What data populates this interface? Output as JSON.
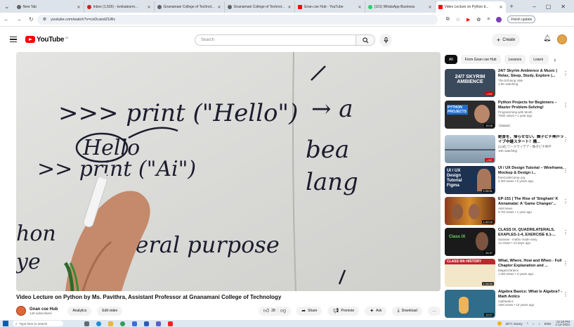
{
  "browser": {
    "tabs": [
      {
        "title": "New Tab",
        "color": "#5f6368"
      },
      {
        "title": "Inbox (1,526) - kvnkatesrm...",
        "color": "#c5221f"
      },
      {
        "title": "Gnanamani College of Technol...",
        "color": "#5f6368"
      },
      {
        "title": "Gnanamani College of Technol...",
        "color": "#5f6368"
      },
      {
        "title": "Gnan cse Hub - YouTube",
        "color": "#ff0000"
      },
      {
        "title": "(101) WhatsApp Business",
        "color": "#25d366"
      },
      {
        "title": "Video Lecture on Python b...",
        "color": "#ff0000"
      }
    ],
    "new_tab_label": "+",
    "window_controls": [
      "–",
      "▢",
      "✕"
    ],
    "url": "youtube.com/watch?v=coDcandZURc",
    "finish_update_label": "Finish update"
  },
  "youtube": {
    "logo_text": "YouTube",
    "country_code": "IN",
    "search_placeholder": "Search",
    "create_label": "Create"
  },
  "video": {
    "title": "Video Lecture on Python by Ms. Pavithra, Assistant Professor at Gnanamani College of Technology",
    "board_lines": [
      ">>> print (\"Hello\")",
      "Hello",
      ">> print (\"Ai\")",
      "hon",
      "eneral purpose",
      "ye",
      "→ a",
      "bea",
      "lang"
    ]
  },
  "channel": {
    "name": "Gnan cse Hub",
    "subscribers": "149 subscribers",
    "analytics_label": "Analytics",
    "edit_label": "Edit video",
    "like_count": "28",
    "share_label": "Share",
    "promote_label": "Promote",
    "ask_label": "Ask",
    "download_label": "Download",
    "more_label": "..."
  },
  "chips": [
    "All",
    "From Gnan cse Hub",
    "Lessons",
    "Learni"
  ],
  "recommendations": [
    {
      "title": "24/7 Skyrim Ambience & Music | Relax, Sleep, Study, Explore |...",
      "channel": "The Echoing Vale",
      "meta": "1.5K watching",
      "badge": "LIVE",
      "thumb_color": "#3a4a5c",
      "thumb_text": "24/7 SKYRIM AMBIENCE"
    },
    {
      "title": "Python Projects for Beginners – Master Problem-Solving!",
      "channel": "Programming with Mosh",
      "meta": "763K views • 1 year ago",
      "badge": "Dubbed",
      "duration": "15:08",
      "thumb_color": "#2b2b2b",
      "thumb_text": "PYTHON PROJECTS"
    },
    {
      "title": "絶景を、帰らせない。舞子ピチ神戸ライブ中継スタート！橋...",
      "channel": "[公式] ワークライデア・舞子ピチ神戸",
      "meta": "10K watching",
      "badge": "LIVE",
      "thumb_color": "#9fb3c4",
      "thumb_text": ""
    },
    {
      "title": "UI / UX Design Tutorial – Wireframe, Mockup & Design i...",
      "channel": "freeCodeCamp.org",
      "meta": "2.2M views • 5 years ago",
      "duration": "1:26:31",
      "thumb_color": "#1d3150",
      "thumb_text": "UI / UX Design Tutorial Figma"
    },
    {
      "title": "EP-151 | The Rise of 'Singham' K Annamalai: A 'Game Changer'...",
      "channel": "AIM News",
      "meta": "5.7M views • 1 year ago",
      "duration": "1:42:16",
      "thumb_color": "#8a3d1e",
      "thumb_text": ""
    },
    {
      "title": "CLASS IX, QUADRILATERALS, EXAPLES-1-4, EXERCISE 8.1-...",
      "channel": "Saraswi - maths made easy",
      "meta": "12 views • 13 days ago",
      "duration": "26:37",
      "thumb_color": "#1a1a1a",
      "thumb_text": "Class IX"
    },
    {
      "title": "What, Where, How and When - Full Chapter Explanation and ...",
      "channel": "Magnet Brains",
      "meta": "1.4M views • 3 years ago",
      "duration": "1:16:30",
      "thumb_color": "#f3e7c9",
      "thumb_text": "CLASS 6th HISTORY"
    },
    {
      "title": "Algebra Basics: What Is Algebra? - Math Antics",
      "channel": "mathantics",
      "meta": "16M views • 10 years ago",
      "duration": "12:07",
      "thumb_color": "#2f6d8a",
      "thumb_text": ""
    }
  ],
  "taskbar": {
    "search_placeholder": "Type here to search",
    "weather": "30°C Sunny",
    "lang": "ENG",
    "time": "12:18 PM",
    "date": "1-12-2024"
  }
}
